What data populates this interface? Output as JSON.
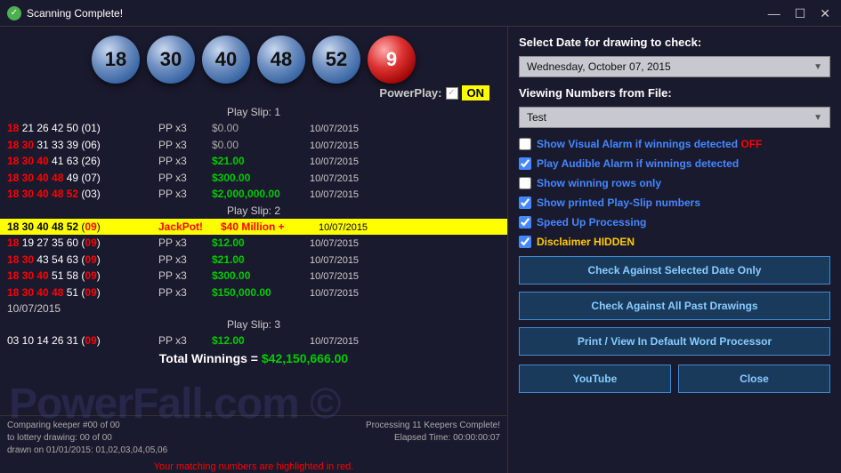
{
  "window": {
    "title": "Scanning Complete!",
    "icon": "✓",
    "controls": {
      "minimize": "—",
      "maximize": "☐",
      "close": "✕"
    }
  },
  "balls": [
    {
      "value": "18",
      "type": "blue"
    },
    {
      "value": "30",
      "type": "blue"
    },
    {
      "value": "40",
      "type": "blue"
    },
    {
      "value": "48",
      "type": "blue"
    },
    {
      "value": "52",
      "type": "blue"
    },
    {
      "value": "9",
      "type": "red"
    }
  ],
  "powerplay": {
    "label": "PowerPlay:",
    "on_text": "ON"
  },
  "right_panel": {
    "date_label": "Select Date for drawing to check:",
    "date_value": "Wednesday, October 07, 2015",
    "file_label": "Viewing Numbers from File:",
    "file_value": "Test",
    "checkboxes": [
      {
        "id": "cb1",
        "checked": false,
        "label": "Show Visual Alarm if winnings detected",
        "badge": "OFF",
        "color": "blue"
      },
      {
        "id": "cb2",
        "checked": true,
        "label": "Play Audible Alarm if winnings detected",
        "color": "blue"
      },
      {
        "id": "cb3",
        "checked": false,
        "label": "Show winning rows only",
        "color": "blue"
      },
      {
        "id": "cb4",
        "checked": true,
        "label": "Show printed Play-Slip numbers",
        "color": "blue"
      },
      {
        "id": "cb5",
        "checked": true,
        "label": "Speed Up Processing",
        "color": "blue"
      },
      {
        "id": "cb6",
        "checked": true,
        "label": "Disclaimer HIDDEN",
        "color": "yellow"
      }
    ],
    "buttons": {
      "check_selected": "Check Against Selected Date Only",
      "check_all": "Check Against All Past Drawings",
      "print_view": "Print / View In Default Word Processor",
      "youtube": "YouTube",
      "close": "Close"
    }
  },
  "results": {
    "slip1_header": "Play Slip: 1",
    "slip2_header": "Play Slip: 2",
    "slip3_header": "Play Slip: 3",
    "rows_slip1": [
      {
        "nums": "18 21 26 42 50 (01)",
        "pp": "PP x3",
        "win": "$0.00",
        "date": "10/07/2015"
      },
      {
        "nums": "18 30 31 33 39 (06)",
        "pp": "PP x3",
        "win": "$0.00",
        "date": "10/07/2015"
      },
      {
        "nums": "18 30 40 41 63 (26)",
        "pp": "PP x3",
        "win": "$21.00",
        "date": "10/07/2015"
      },
      {
        "nums": "18 30 40 48 49 (07)",
        "pp": "PP x3",
        "win": "$300.00",
        "date": "10/07/2015"
      },
      {
        "nums": "18 30 40 48 52 (03)",
        "pp": "PP x3",
        "win": "$2,000,000.00",
        "date": "10/07/2015"
      }
    ],
    "rows_slip2": [
      {
        "nums": "18 30 40 48 52 (09)",
        "pp": "",
        "win": "JackPot!",
        "win2": "$40 Million +",
        "date": "10/07/2015",
        "jackpot": true
      },
      {
        "nums": "18 19 27 35 60 (09)",
        "pp": "PP x3",
        "win": "$12.00",
        "date": "10/07/2015"
      },
      {
        "nums": "18 30 43 54 63 (09)",
        "pp": "PP x3",
        "win": "$21.00",
        "date": "10/07/2015"
      },
      {
        "nums": "18 30 40 51 58 (09)",
        "pp": "PP x3",
        "win": "$300.00",
        "date": "10/07/2015"
      },
      {
        "nums": "18 30 40 48 51 (09)",
        "pp": "PP x3",
        "win": "$150,000.00",
        "date": "10/07/2015"
      }
    ],
    "date_row": "10/07/2015",
    "rows_slip3": [
      {
        "nums": "03 10 14 26 31 (09)",
        "pp": "PP x3",
        "win": "$12.00",
        "date": "10/07/2015"
      }
    ],
    "total": "Total Winnings = $42,150,666.00"
  },
  "status": {
    "left_line1": "Comparing keeper #00 of 00",
    "left_line2": "to lottery drawing: 00 of 00",
    "left_line3": "drawn on 01/01/2015: 01,02,03,04,05,06",
    "right_line1": "Processing 11 Keepers Complete!",
    "right_line2": "Elapsed Time: 00:00:00:07"
  },
  "watermark": "PowerFall.com ©",
  "warning": "Your matching numbers are highlighted in red."
}
